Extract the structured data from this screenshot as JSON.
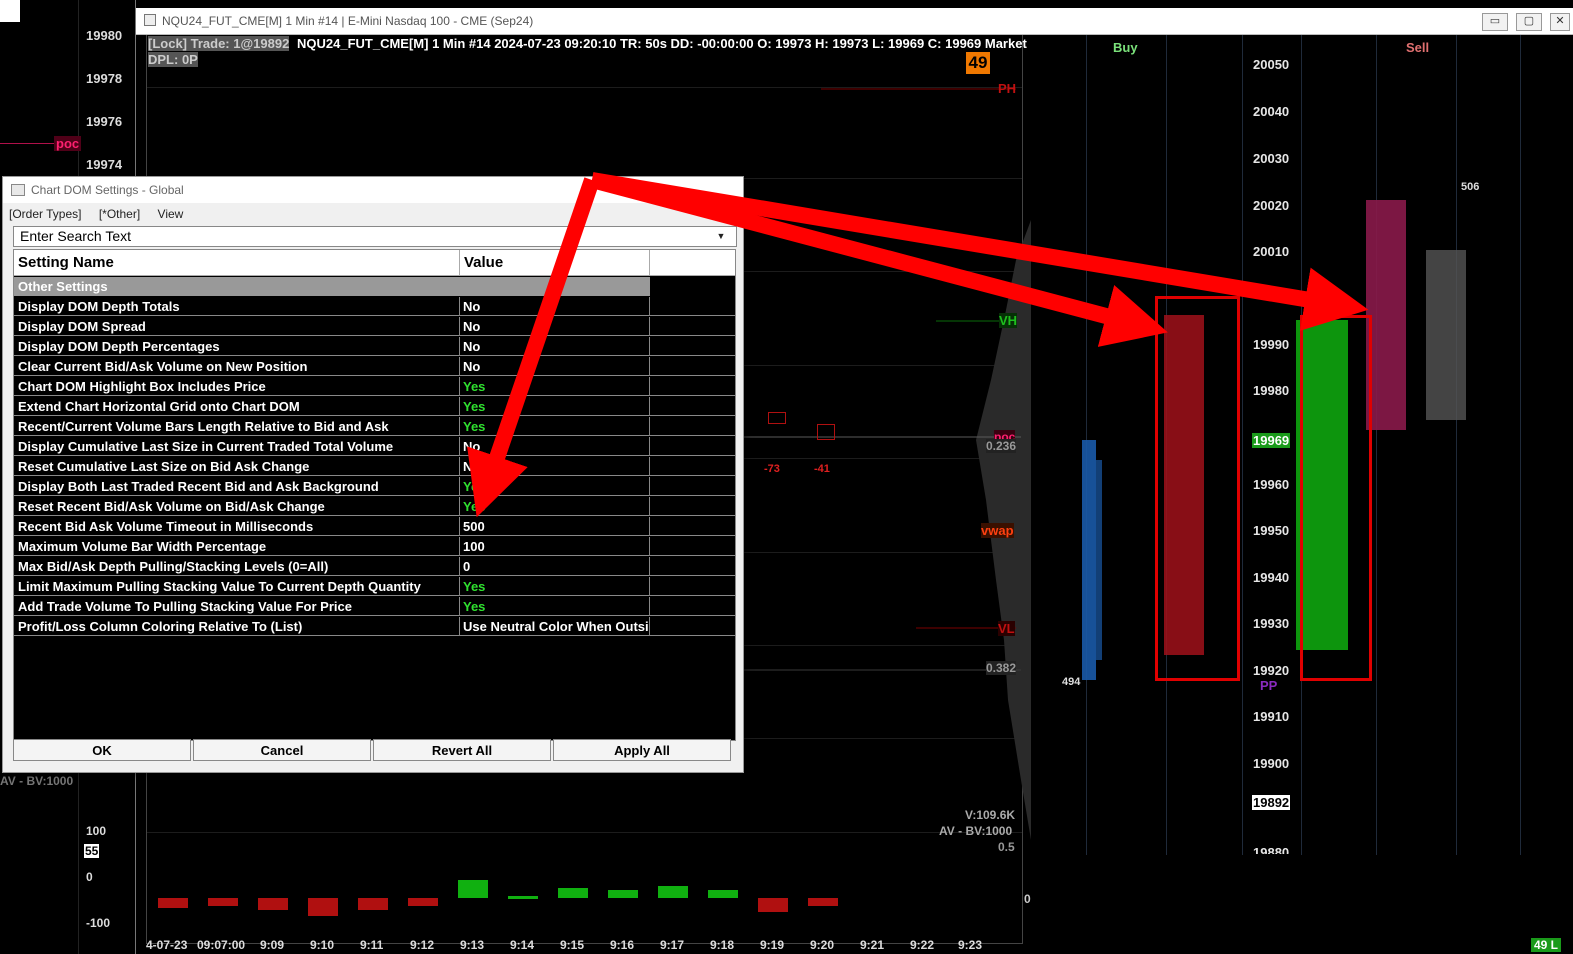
{
  "left_chart": {
    "prices": [
      "19980",
      "19978",
      "19976",
      "19974"
    ],
    "poc_label": "poc",
    "bv_label": "AV - BV:1000",
    "osc_labels": [
      "100",
      "0",
      "-100"
    ],
    "osc_badge": "55"
  },
  "window": {
    "title": "NQU24_FUT_CME[M]  1 Min  #14 | E-Mini Nasdaq 100 - CME (Sep24)",
    "btn_min": "▭",
    "btn_max": "▢",
    "btn_close": "✕"
  },
  "chart": {
    "header_gray": "[Lock] Trade: 1@19892",
    "header_white": "NQU24_FUT_CME[M]  1 Min  #14 2024-07-23 09:20:10 TR: 50s DD: -00:00:00 O: 19973 H: 19973 L: 19969 C: 19969 Market",
    "dpl": "DPL: 0P",
    "badge": "49",
    "ph": "PH",
    "vh": "VH",
    "poc": "poc",
    "fib_236": "0.236",
    "vwap": "vwap",
    "vl": "VL",
    "fib_382": "0.382",
    "fib_05": "0.5",
    "volume": "V:109.6K",
    "av_bv": "AV - BV:1000",
    "neg73": "-73",
    "neg41": "-41",
    "osc_zero": "0"
  },
  "time_axis": [
    "4-07-23",
    "09:07:00",
    "9:09",
    "9:10",
    "9:11",
    "9:12",
    "9:13",
    "9:14",
    "9:15",
    "9:16",
    "9:17",
    "9:18",
    "9:19",
    "9:20",
    "9:21",
    "9:22",
    "9:23"
  ],
  "dom": {
    "buy_label": "Buy",
    "sell_label": "Sell",
    "prices": [
      "20050",
      "20040",
      "20030",
      "20020",
      "20010",
      "19990",
      "19980",
      "19960",
      "19950",
      "19940",
      "19930",
      "19920",
      "19910",
      "19900"
    ],
    "current_price": "19969",
    "trade_price": "19892",
    "bottom_partial": "19880",
    "pp": "PP",
    "left_total": "494",
    "right_total": "506",
    "bottom_right": "49 L"
  },
  "dialog": {
    "title": "Chart DOM Settings - Global",
    "menu": [
      "[Order Types]",
      "[*Other]",
      "View"
    ],
    "search_placeholder": "Enter Search Text",
    "col_name": "Setting Name",
    "col_value": "Value",
    "section": "Other Settings",
    "rows": [
      {
        "name": "Display DOM Depth Totals",
        "value": "No"
      },
      {
        "name": "Display DOM Spread",
        "value": "No"
      },
      {
        "name": "Display DOM Depth Percentages",
        "value": "No"
      },
      {
        "name": "Clear Current Bid/Ask Volume on New Position",
        "value": "No"
      },
      {
        "name": "Chart DOM Highlight Box Includes Price",
        "value": "Yes"
      },
      {
        "name": "Extend Chart Horizontal Grid onto Chart DOM",
        "value": "Yes"
      },
      {
        "name": "Recent/Current Volume Bars Length Relative to Bid and Ask",
        "value": "Yes"
      },
      {
        "name": "Display Cumulative Last Size in Current Traded Total Volume",
        "value": "No"
      },
      {
        "name": "Reset Cumulative Last Size on Bid Ask Change",
        "value": "No"
      },
      {
        "name": "Display Both Last Traded Recent Bid and Ask Background",
        "value": "Yes"
      },
      {
        "name": "Reset Recent Bid/Ask Volume on Bid/Ask Change",
        "value": "Yes"
      },
      {
        "name": "Recent Bid Ask Volume Timeout in Milliseconds",
        "value": "500"
      },
      {
        "name": "Maximum Volume Bar Width Percentage",
        "value": "100"
      },
      {
        "name": "Max Bid/Ask Depth Pulling/Stacking Levels (0=All)",
        "value": "0"
      },
      {
        "name": "Limit Maximum Pulling Stacking Value To Current Depth Quantity",
        "value": "Yes"
      },
      {
        "name": "Add Trade Volume To Pulling Stacking Value For Price",
        "value": "Yes"
      },
      {
        "name": "Profit/Loss Column Coloring Relative To (List)",
        "value": "Use Neutral Color When Outsi"
      }
    ],
    "btn_ok": "OK",
    "btn_cancel": "Cancel",
    "btn_revert": "Revert All",
    "btn_apply": "Apply All"
  },
  "colors": {
    "yes": "#2fe02f",
    "bid_bar": "#a0101a",
    "ask_bar": "#0ea50e",
    "annotation_red": "#ff0000",
    "dom_blue": "#1a5aa8",
    "dom_magenta": "#8a1a4a"
  }
}
